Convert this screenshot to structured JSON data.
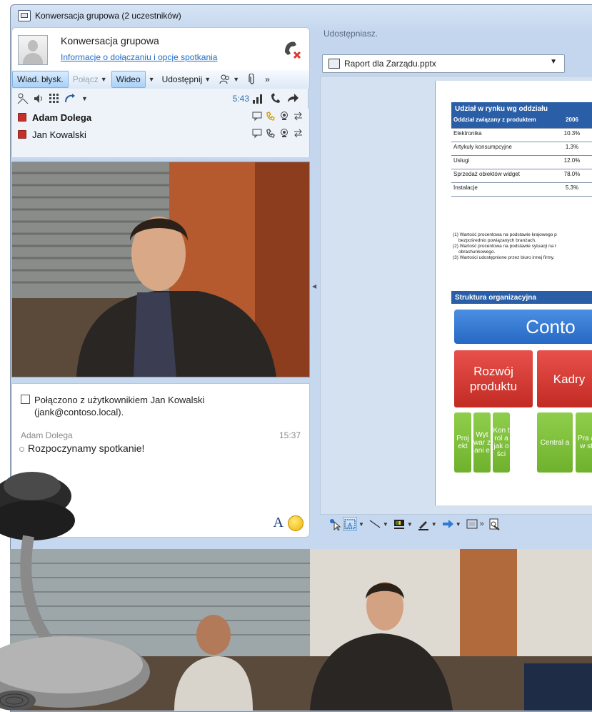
{
  "window": {
    "title": "Konwersacja grupowa (2 uczestników)"
  },
  "header": {
    "conversation_title": "Konwersacja grupowa",
    "join_link": "Informacje o dołączaniu i opcje spotkania"
  },
  "toolbar": {
    "im_label": "Wiad. błysk.",
    "call_label": "Połącz",
    "video_label": "Wideo",
    "share_label": "Udostępnij",
    "more_label": "»"
  },
  "call_status": {
    "timer": "5:43"
  },
  "participants": [
    {
      "name": "Adam Dolega",
      "bold": true
    },
    {
      "name": "Jan Kowalski",
      "bold": false
    }
  ],
  "chat": {
    "system_message_line1": "Połączono z użytkownikiem Jan Kowalski",
    "system_message_line2": "(jank@contoso.local).",
    "sender": "Adam Dolega",
    "time": "15:37",
    "message": "Rozpoczynamy spotkanie!",
    "font_button": "A"
  },
  "sharing": {
    "label": "Udostępniasz.",
    "file": "Raport dla Zarządu.pptx"
  },
  "slide": {
    "table_title": "Udział w rynku wg oddziału",
    "header": [
      "Oddział związany z produktem",
      "2006"
    ],
    "rows": [
      [
        "Elektronika",
        "10.3%"
      ],
      [
        "Artykuły konsumpcyjne",
        "1.3%"
      ],
      [
        "Usługi",
        "12.0%"
      ],
      [
        "Sprzedaż obiektów widget",
        "78.0%"
      ],
      [
        "Instalacje",
        "5.3%"
      ]
    ],
    "notes": [
      "(1) Wartość procentowa na podstawie krajowego p",
      "bezpośrednio powiązanych branżach.",
      "(2) Wartość procentowa na podstawie sytuacji na ł",
      "obrachunkowego.",
      "(3) Wartości udostępnione przez biuro innej firmy."
    ],
    "org_title": "Struktura organizacyjna",
    "org_top": "Conto",
    "org_level2": [
      "Rozwój produktu",
      "Kadry"
    ],
    "org_level3": [
      "Proj ekt",
      "Wyt war zani e",
      "Kon trol a jak ości",
      "Central a",
      "Pra aw st"
    ]
  },
  "colors": {
    "accent_blue": "#2a5fa8",
    "link_blue": "#1f6cc7",
    "red_box": "#c22b24",
    "green_box": "#6fb12c",
    "status_red": "#c4312a"
  }
}
